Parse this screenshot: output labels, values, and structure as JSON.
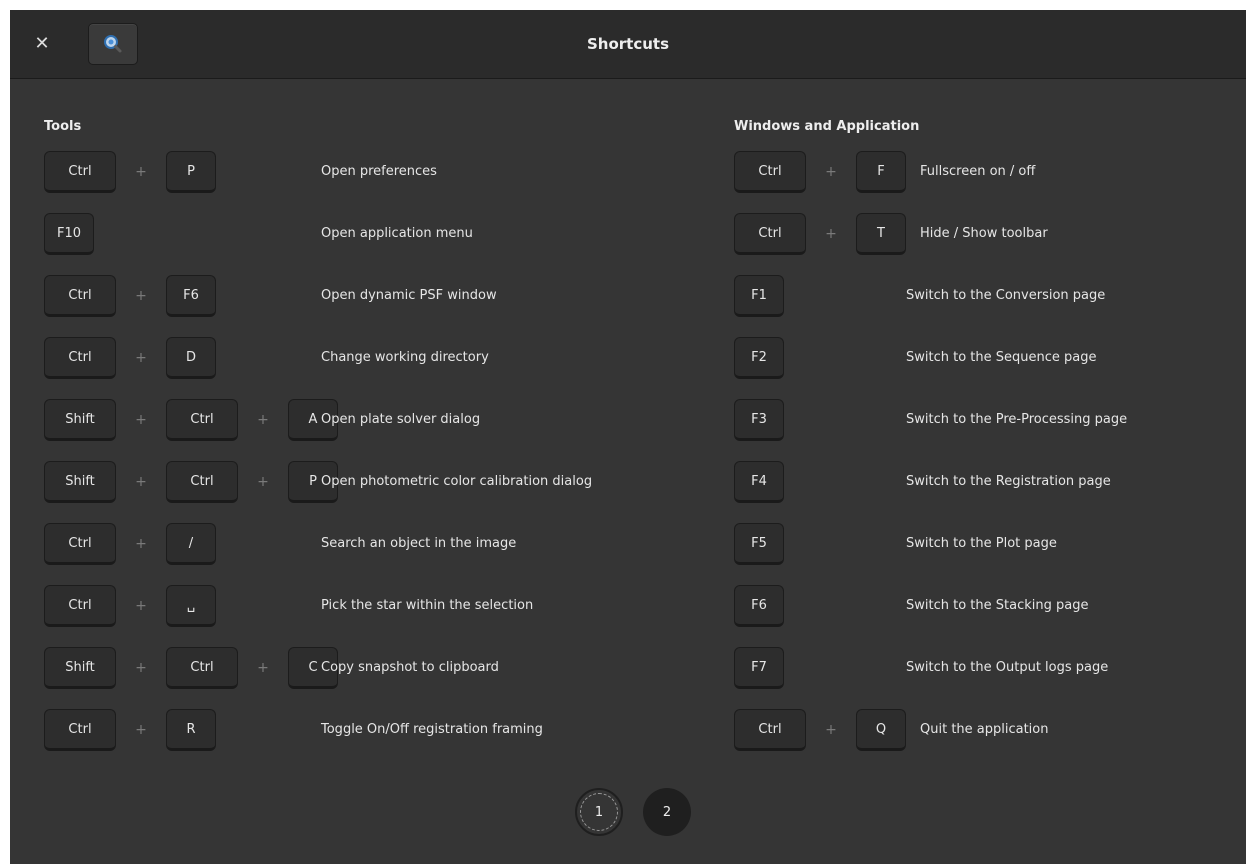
{
  "window": {
    "title": "Shortcuts"
  },
  "icons": {
    "close": "close-icon",
    "search": "search-icon"
  },
  "sections": {
    "tools": {
      "title": "Tools",
      "rows": [
        {
          "keys": [
            "Ctrl",
            "P"
          ],
          "desc": "Open preferences"
        },
        {
          "keys": [
            "F10"
          ],
          "desc": "Open application menu"
        },
        {
          "keys": [
            "Ctrl",
            "F6"
          ],
          "desc": "Open dynamic PSF window"
        },
        {
          "keys": [
            "Ctrl",
            "D"
          ],
          "desc": "Change working directory"
        },
        {
          "keys": [
            "Shift",
            "Ctrl",
            "A"
          ],
          "desc": "Open plate solver dialog"
        },
        {
          "keys": [
            "Shift",
            "Ctrl",
            "P"
          ],
          "desc": "Open photometric color calibration dialog"
        },
        {
          "keys": [
            "Ctrl",
            "/"
          ],
          "desc": "Search an object in the image"
        },
        {
          "keys": [
            "Ctrl",
            "␣"
          ],
          "desc": "Pick the star within the selection"
        },
        {
          "keys": [
            "Shift",
            "Ctrl",
            "C"
          ],
          "desc": "Copy snapshot to clipboard"
        },
        {
          "keys": [
            "Ctrl",
            "R"
          ],
          "desc": "Toggle On/Off registration framing"
        }
      ]
    },
    "windows": {
      "title": "Windows and Application",
      "rows": [
        {
          "keys": [
            "Ctrl",
            "F"
          ],
          "desc": "Fullscreen on / off"
        },
        {
          "keys": [
            "Ctrl",
            "T"
          ],
          "desc": "Hide / Show toolbar"
        },
        {
          "keys": [
            "F1"
          ],
          "desc": "Switch to the Conversion page"
        },
        {
          "keys": [
            "F2"
          ],
          "desc": "Switch to the Sequence page"
        },
        {
          "keys": [
            "F3"
          ],
          "desc": "Switch to the Pre-Processing page"
        },
        {
          "keys": [
            "F4"
          ],
          "desc": "Switch to the Registration page"
        },
        {
          "keys": [
            "F5"
          ],
          "desc": "Switch to the Plot page"
        },
        {
          "keys": [
            "F6"
          ],
          "desc": "Switch to the Stacking page"
        },
        {
          "keys": [
            "F7"
          ],
          "desc": "Switch to the Output logs page"
        },
        {
          "keys": [
            "Ctrl",
            "Q"
          ],
          "desc": "Quit the application"
        }
      ]
    }
  },
  "pagination": {
    "pages": [
      "1",
      "2"
    ],
    "current": "1"
  }
}
